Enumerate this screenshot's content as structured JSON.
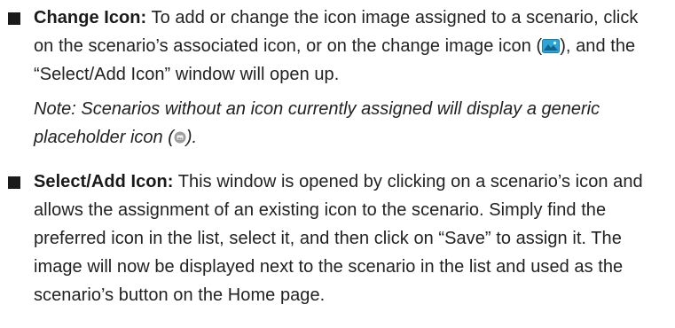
{
  "items": [
    {
      "title": "Change Icon:",
      "text_1": " To add or change the icon image assigned to a scenario, click on the scenario’s associated icon, or on the change image icon (",
      "icon_name": "change-image-icon",
      "text_2": "), and the “Select/Add Icon” window will open up.",
      "note": {
        "text_1": "Note: Scenarios without an icon currently assigned will display a generic placeholder icon (",
        "icon_name": "placeholder-icon",
        "text_2": ")."
      }
    },
    {
      "title": "Select/Add Icon:",
      "text": " This window is opened by clicking on a scenario’s icon and allows the assignment of an existing icon to the scenario. Simply find the preferred icon in the list, select it, and then click on “Save” to assign it. The image will now be displayed next to the scenario in the list and used as the scenario’s button on the Home page."
    }
  ],
  "colors": {
    "text": "#222222",
    "change_icon_bg": "#2aa7d6",
    "change_icon_mountains": "#1b5f8c",
    "placeholder_icon_bg": "#9e9e9e"
  }
}
